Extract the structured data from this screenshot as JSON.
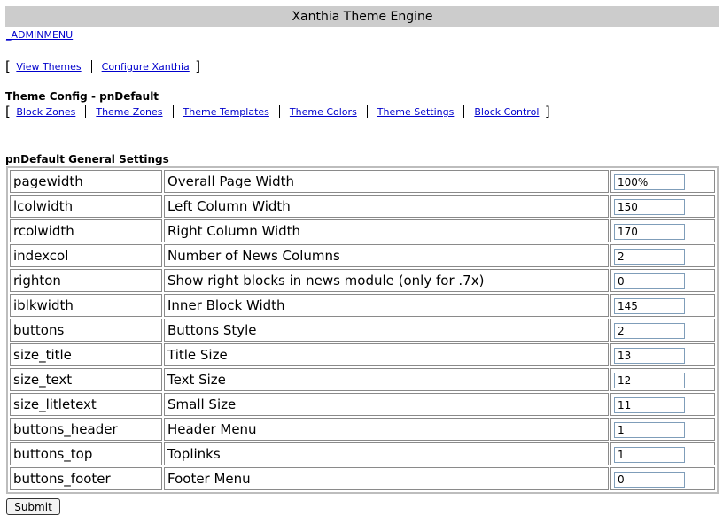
{
  "header": {
    "title": "Xanthia Theme Engine"
  },
  "admin_link": "_ADMINMENU",
  "top_nav": {
    "items": [
      "View Themes",
      "Configure Xanthia"
    ]
  },
  "theme_config": {
    "title": "Theme Config - pnDefault",
    "tabs": [
      "Block Zones",
      "Theme Zones",
      "Theme Templates",
      "Theme Colors",
      "Theme Settings",
      "Block Control"
    ]
  },
  "settings": {
    "title": "pnDefault General Settings",
    "rows": [
      {
        "key": "pagewidth",
        "desc": "Overall Page Width",
        "value": "100%"
      },
      {
        "key": "lcolwidth",
        "desc": "Left Column Width",
        "value": "150"
      },
      {
        "key": "rcolwidth",
        "desc": "Right Column Width",
        "value": "170"
      },
      {
        "key": "indexcol",
        "desc": "Number of News Columns",
        "value": "2"
      },
      {
        "key": "righton",
        "desc": "Show right blocks in news module (only for .7x)",
        "value": "0"
      },
      {
        "key": "iblkwidth",
        "desc": "Inner Block Width",
        "value": "145"
      },
      {
        "key": "buttons",
        "desc": "Buttons Style",
        "value": "2"
      },
      {
        "key": "size_title",
        "desc": "Title Size",
        "value": "13"
      },
      {
        "key": "size_text",
        "desc": "Text Size",
        "value": "12"
      },
      {
        "key": "size_litletext",
        "desc": "Small Size",
        "value": "11"
      },
      {
        "key": "buttons_header",
        "desc": "Header Menu",
        "value": "1"
      },
      {
        "key": "buttons_top",
        "desc": "Toplinks",
        "value": "1"
      },
      {
        "key": "buttons_footer",
        "desc": "Footer Menu",
        "value": "0"
      }
    ]
  },
  "submit_label": "Submit"
}
